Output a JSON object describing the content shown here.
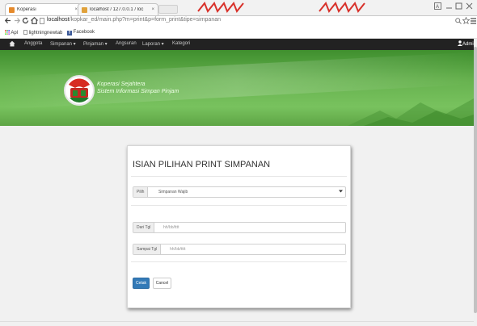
{
  "browser": {
    "tabs": [
      {
        "title": "Koperasi",
        "close": "×"
      },
      {
        "title": "localhost / 127.0.0.1 / loc",
        "close": "×"
      }
    ],
    "url_host": "localhost",
    "url_path": "/kopkar_ed/main.php?m=print&p=form_print&tipe=simpanan",
    "bookmarks": [
      {
        "label": "Apl"
      },
      {
        "label": "lightningnewtab"
      },
      {
        "label": "Facebook"
      }
    ]
  },
  "navbar": {
    "items": [
      {
        "label": "Anggota"
      },
      {
        "label": "Simpanan ▾"
      },
      {
        "label": "Pinjaman ▾"
      },
      {
        "label": "Angsuran"
      },
      {
        "label": "Laporan ▾"
      },
      {
        "label": "Kategori"
      }
    ],
    "user_label": "Admin"
  },
  "banner": {
    "title": "Koperasi Sejahtera",
    "subtitle": "Sistem Informasi Simpan Pinjam"
  },
  "form": {
    "title": "ISIAN PILIHAN PRINT SIMPANAN",
    "pilih_label": "Pilih",
    "pilih_value": "Simpanan Wajib",
    "dari_label": "Dari Tgl",
    "dari_placeholder": "hh/bb/tttt",
    "sampai_label": "Sampai Tgl",
    "sampai_placeholder": "hh/bb/tttt",
    "cetak_label": "Cetak",
    "cancel_label": "Cancel"
  },
  "colors": {
    "navbar": "#222222",
    "banner": "#67b24f",
    "primary_button": "#337ab7"
  }
}
